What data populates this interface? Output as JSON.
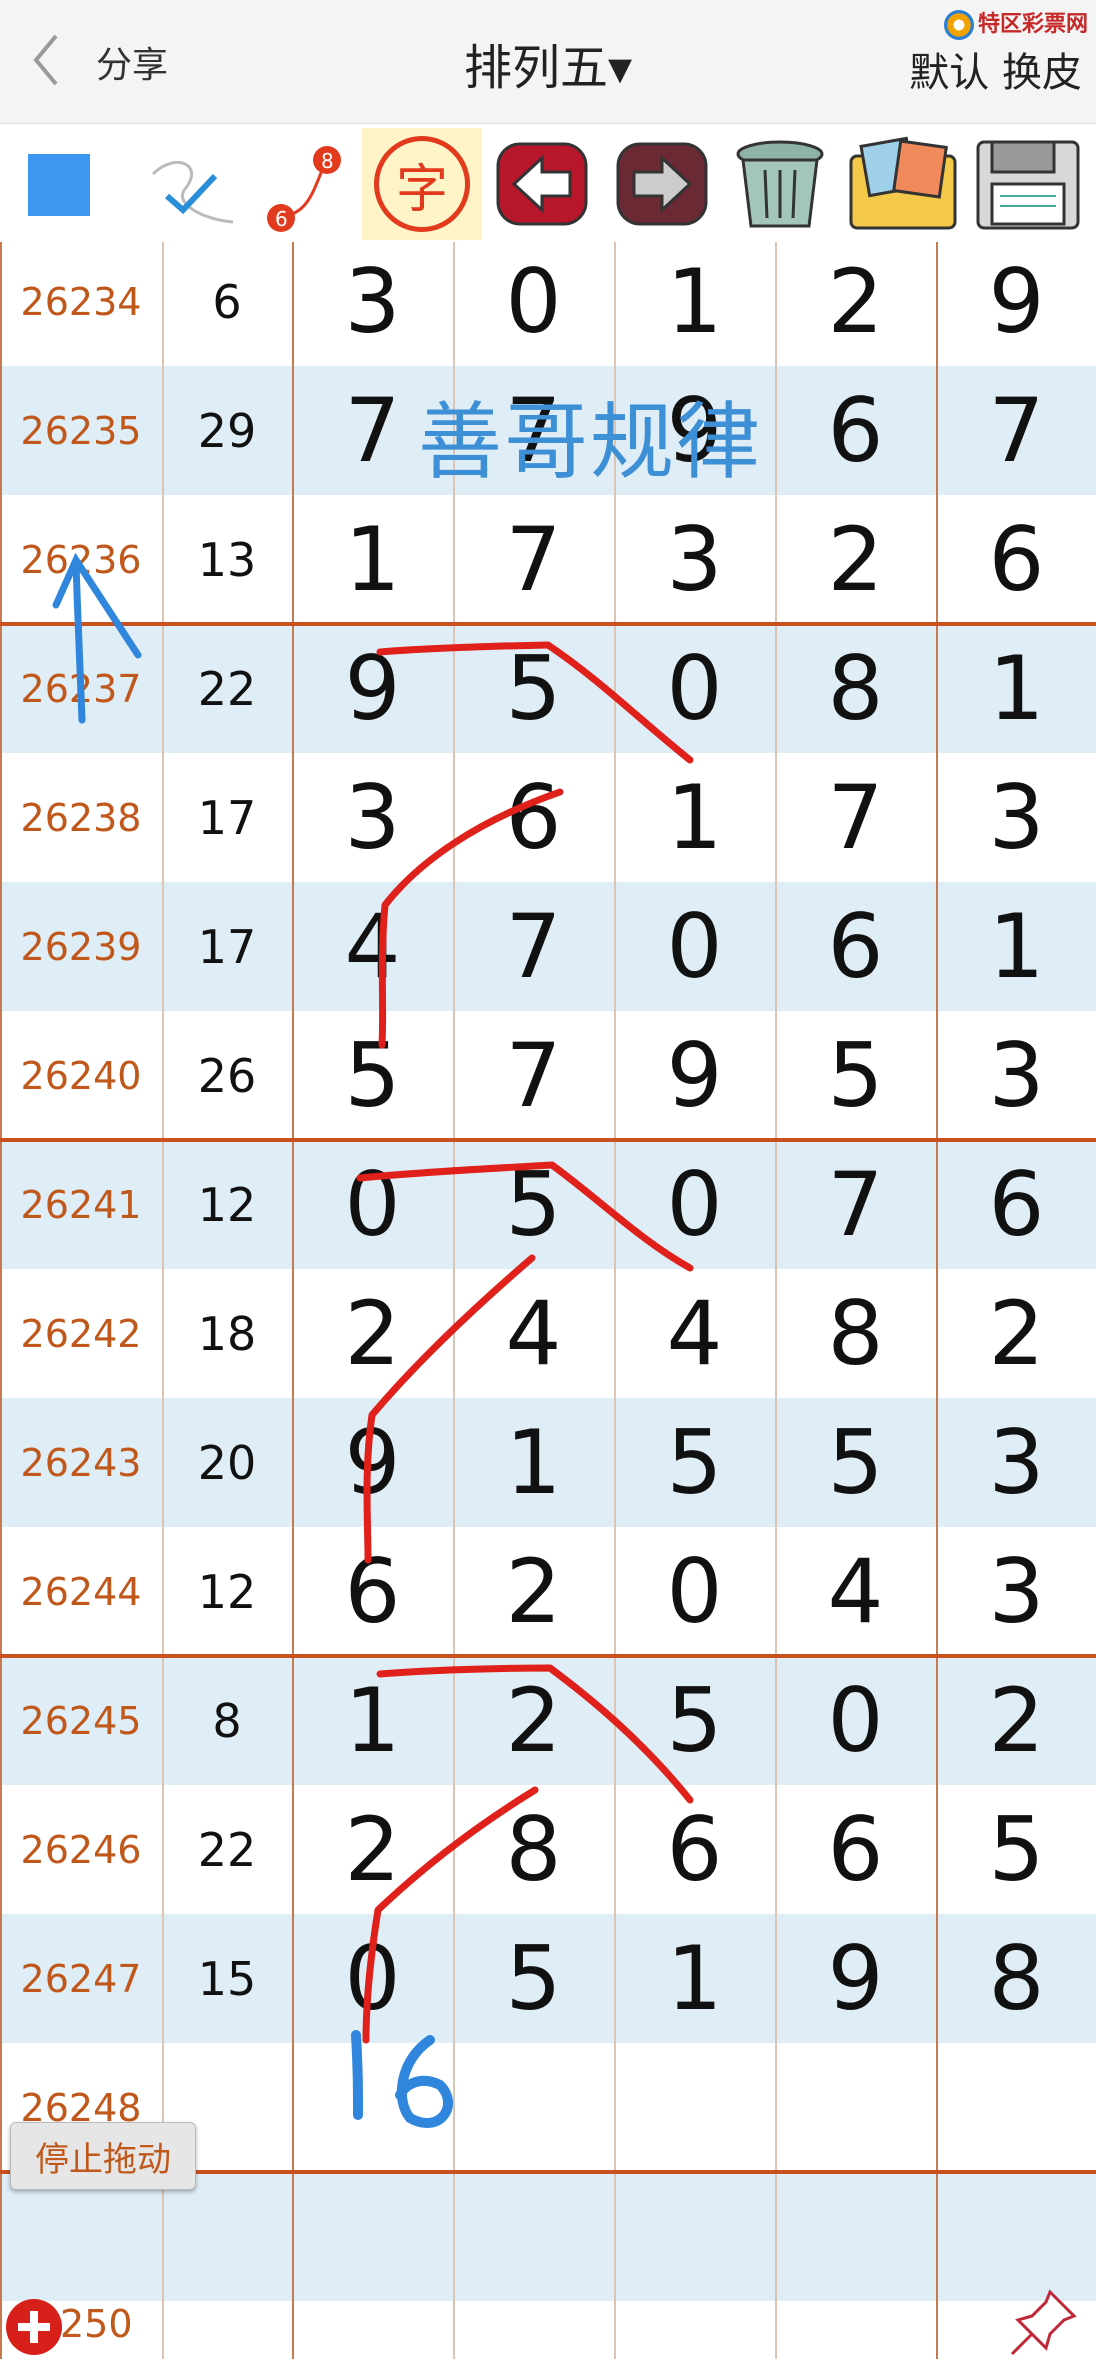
{
  "header": {
    "share_label": "分享",
    "title": "排列五▾",
    "skin_label": "默认 换皮",
    "logo_text": "特区彩票网"
  },
  "toolbar": {
    "icons": [
      "blue-square-icon",
      "check-pen-icon",
      "line-6-8-icon",
      "zi-character-icon",
      "back-arrow-icon",
      "forward-arrow-icon",
      "trash-icon",
      "photos-icon",
      "save-disk-icon"
    ],
    "badge_6": "6",
    "badge_8": "8",
    "zi": "字",
    "accent": "#3d8fd6"
  },
  "rows": [
    {
      "issue": "26234",
      "sum": "6",
      "d": [
        "3",
        "0",
        "1",
        "2",
        "9"
      ]
    },
    {
      "issue": "26235",
      "sum": "29",
      "d": [
        "7",
        "7",
        "9",
        "6",
        "7"
      ]
    },
    {
      "issue": "26236",
      "sum": "13",
      "d": [
        "1",
        "7",
        "3",
        "2",
        "6"
      ]
    },
    {
      "issue": "26237",
      "sum": "22",
      "d": [
        "9",
        "5",
        "0",
        "8",
        "1"
      ]
    },
    {
      "issue": "26238",
      "sum": "17",
      "d": [
        "3",
        "6",
        "1",
        "7",
        "3"
      ]
    },
    {
      "issue": "26239",
      "sum": "17",
      "d": [
        "4",
        "7",
        "0",
        "6",
        "1"
      ]
    },
    {
      "issue": "26240",
      "sum": "26",
      "d": [
        "5",
        "7",
        "9",
        "5",
        "3"
      ]
    },
    {
      "issue": "26241",
      "sum": "12",
      "d": [
        "0",
        "5",
        "0",
        "7",
        "6"
      ]
    },
    {
      "issue": "26242",
      "sum": "18",
      "d": [
        "2",
        "4",
        "4",
        "8",
        "2"
      ]
    },
    {
      "issue": "26243",
      "sum": "20",
      "d": [
        "9",
        "1",
        "5",
        "5",
        "3"
      ]
    },
    {
      "issue": "26244",
      "sum": "12",
      "d": [
        "6",
        "2",
        "0",
        "4",
        "3"
      ]
    },
    {
      "issue": "26245",
      "sum": "8",
      "d": [
        "1",
        "2",
        "5",
        "0",
        "2"
      ]
    },
    {
      "issue": "26246",
      "sum": "22",
      "d": [
        "2",
        "8",
        "6",
        "6",
        "5"
      ]
    },
    {
      "issue": "26247",
      "sum": "15",
      "d": [
        "0",
        "5",
        "1",
        "9",
        "8"
      ]
    },
    {
      "issue": "26248",
      "sum": "",
      "d": [
        "",
        "",
        "",
        "",
        ""
      ]
    },
    {
      "issue": "",
      "sum": "",
      "d": [
        "",
        "",
        "",
        "",
        ""
      ]
    },
    {
      "issue": "",
      "sum": "",
      "d": [
        "",
        "",
        "",
        "",
        ""
      ]
    }
  ],
  "watermark": "善哥规律",
  "handwritten_note": "16",
  "stop_button": "停止拖动",
  "last_issue_partial": "250",
  "colors": {
    "issue_text": "#c0581b",
    "row_blue": "#dfedf6",
    "separator": "#c8511f",
    "ink_red": "#e0201a",
    "ink_blue": "#2f86dc"
  }
}
